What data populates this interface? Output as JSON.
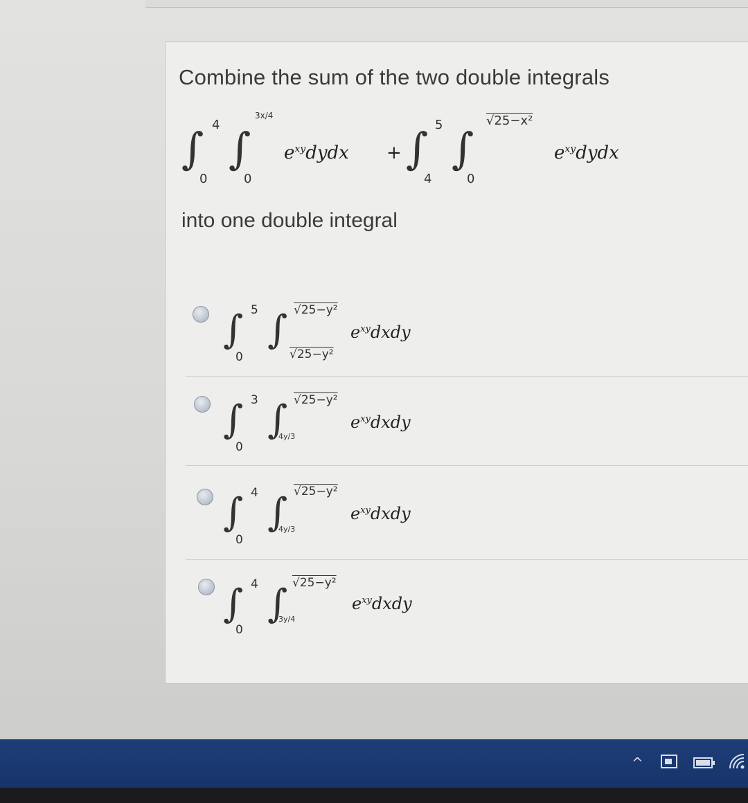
{
  "question": {
    "title": "Combine the sum of the two double integrals",
    "given": {
      "first": {
        "outer_upper": "4",
        "outer_lower": "0",
        "inner_upper": "3x/4",
        "inner_lower": "0",
        "integrand": "e",
        "exponent": "xy",
        "differential": "dydx"
      },
      "plus": "+",
      "second": {
        "outer_upper": "5",
        "outer_lower": "4",
        "inner_upper": "√25−x²",
        "inner_lower": "0",
        "integrand": "e",
        "exponent": "xy",
        "differential": "dydx"
      }
    },
    "subtitle": "into one double integral"
  },
  "options": [
    {
      "outer_upper": "5",
      "outer_lower": "0",
      "inner_upper": "√25−y²",
      "inner_lower": "√25−y²",
      "integrand": "e",
      "exponent": "xy",
      "differential": "dxdy"
    },
    {
      "outer_upper": "3",
      "outer_lower": "0",
      "inner_upper": "√25−y²",
      "inner_lower": "4y/3",
      "integrand": "e",
      "exponent": "xy",
      "differential": "dxdy"
    },
    {
      "outer_upper": "4",
      "outer_lower": "0",
      "inner_upper": "√25−y²",
      "inner_lower": "4y/3",
      "integrand": "e",
      "exponent": "xy",
      "differential": "dxdy"
    },
    {
      "outer_upper": "4",
      "outer_lower": "0",
      "inner_upper": "√25−y²",
      "inner_lower": "3y/4",
      "integrand": "e",
      "exponent": "xy",
      "differential": "dxdy"
    }
  ],
  "taskbar": {
    "tray_icons": [
      "chevron-up-icon",
      "network-icon",
      "battery-icon",
      "wifi-icon"
    ]
  }
}
